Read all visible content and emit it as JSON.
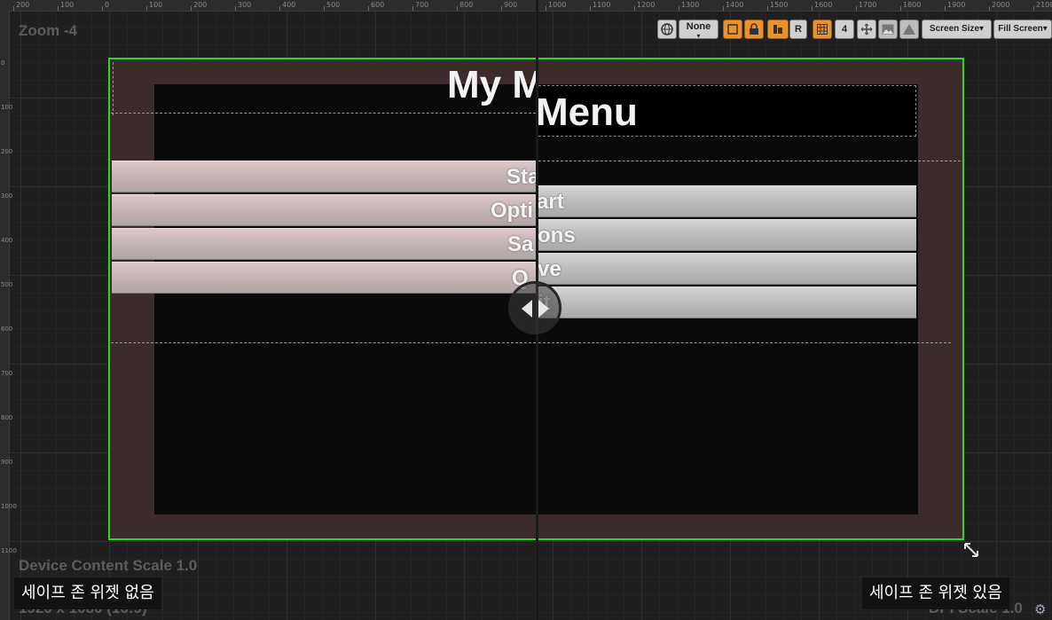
{
  "ruler": {
    "top_labels": [
      "200",
      "100",
      "0",
      "100",
      "200",
      "300",
      "400",
      "500",
      "600",
      "700",
      "800",
      "900",
      "1000",
      "1100",
      "1200",
      "1300",
      "1400",
      "1500",
      "1600",
      "1700",
      "1800",
      "1900",
      "2000",
      "2100"
    ],
    "left_labels": [
      "0",
      "100",
      "200",
      "300",
      "400",
      "500",
      "600",
      "700",
      "800",
      "900",
      "1000",
      "1100"
    ]
  },
  "viewport": {
    "zoom_label": "Zoom -4",
    "device_scale": "Device Content Scale 1.0",
    "resolution": "1920 x 1080 (16:9)",
    "dpi_scale": "DPI Scale 1.0"
  },
  "toolbar": {
    "culture_icon": "globe-icon",
    "none_label": "None",
    "r_label": "R",
    "grid_count": "4",
    "screen_size_label": "Screen Size▾",
    "fill_screen_label": "Fill Screen▾"
  },
  "left_panel": {
    "title": "My M",
    "buttons": [
      "Sta",
      "Opti",
      "Sa",
      "Q"
    ]
  },
  "right_panel": {
    "title": "Menu",
    "buttons": [
      "art",
      "ons",
      "ve",
      "it"
    ]
  },
  "captions": {
    "left": "세이프 존 위젯 없음",
    "right": "세이프 존 위젯 있음"
  },
  "colors": {
    "selection_border": "#26d926",
    "safe_zone_bg": "#3b2b2b",
    "accent_orange": "#e8932e"
  }
}
